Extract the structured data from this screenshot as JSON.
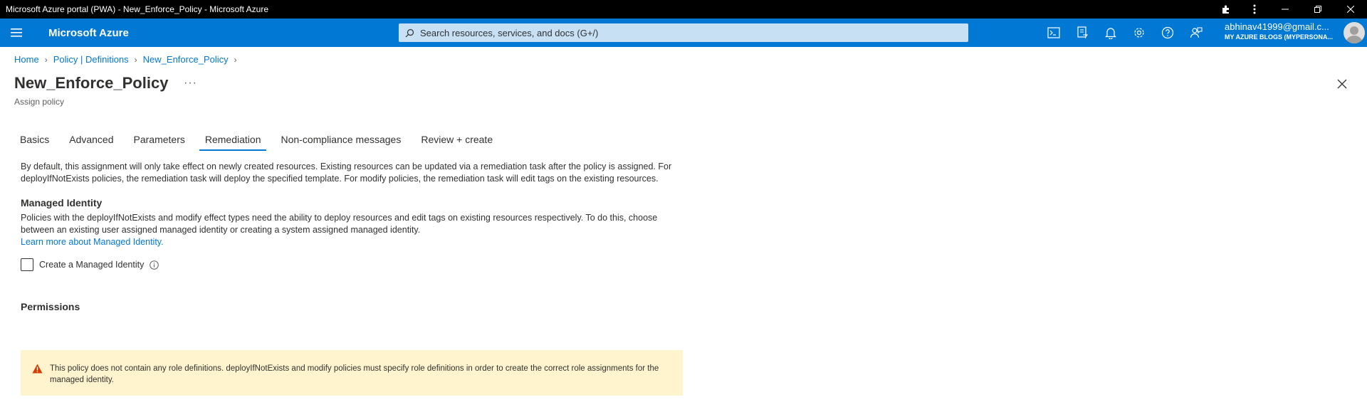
{
  "window": {
    "title": "Microsoft Azure portal (PWA) - New_Enforce_Policy - Microsoft Azure"
  },
  "header": {
    "brand": "Microsoft Azure",
    "search_placeholder": "Search resources, services, and docs (G+/)",
    "account_email": "abhinav41999@gmail.c...",
    "account_directory": "MY AZURE BLOGS (MYPERSONA..."
  },
  "breadcrumb": {
    "items": [
      "Home",
      "Policy | Definitions",
      "New_Enforce_Policy"
    ]
  },
  "page": {
    "title": "New_Enforce_Policy",
    "subtitle": "Assign policy",
    "more_label": "···"
  },
  "tabs": [
    {
      "label": "Basics",
      "active": false
    },
    {
      "label": "Advanced",
      "active": false
    },
    {
      "label": "Parameters",
      "active": false
    },
    {
      "label": "Remediation",
      "active": true
    },
    {
      "label": "Non-compliance messages",
      "active": false
    },
    {
      "label": "Review + create",
      "active": false
    }
  ],
  "remediation": {
    "intro": "By default, this assignment will only take effect on newly created resources. Existing resources can be updated via a remediation task after the policy is assigned. For deployIfNotExists policies, the remediation task will deploy the specified template. For modify policies, the remediation task will edit tags on the existing resources.",
    "managed_identity_heading": "Managed Identity",
    "managed_identity_text": "Policies with the deployIfNotExists and modify effect types need the ability to deploy resources and edit tags on existing resources respectively. To do this, choose between an existing user assigned managed identity or creating a system assigned managed identity.",
    "learn_more": "Learn more about Managed Identity.",
    "create_identity_label": "Create a Managed Identity",
    "create_identity_checked": false,
    "permissions_heading": "Permissions",
    "warning_text": "This policy does not contain any role definitions. deployIfNotExists and modify policies must specify role definitions in order to create the correct role assignments for the managed identity."
  },
  "colors": {
    "accent": "#0078d4",
    "warning_bg": "#fff4ce",
    "warning_icon": "#d83b01"
  }
}
